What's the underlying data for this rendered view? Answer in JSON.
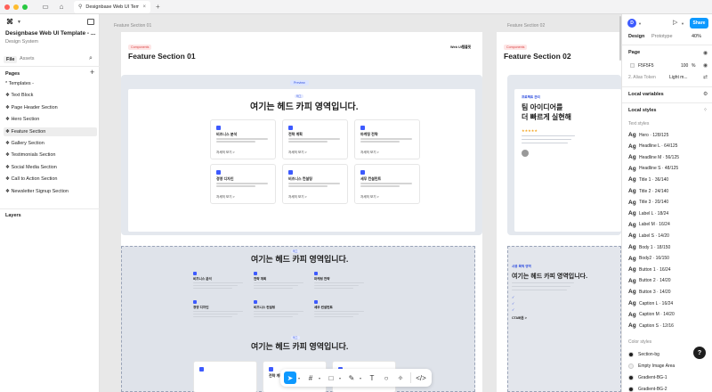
{
  "titlebar": {
    "tab_title": "Designbase Web UI Template - v",
    "close_glyph": "×",
    "plus_glyph": "+",
    "colors": {
      "red": "#ff5f57",
      "yellow": "#febc2e",
      "green": "#28c840"
    }
  },
  "left_panel": {
    "file_title": "Designbase Web UI Template - ...",
    "file_subtitle": "Design System",
    "tabs": [
      "File",
      "Assets"
    ],
    "pages_header": "Pages",
    "pages": [
      "* Templates -",
      "❖ Text Block",
      "❖ Page Header Section",
      "❖ Hero Section",
      "❖ Feature Section",
      "❖ Gallery Section",
      "❖ Testimonials Section",
      "❖ Social Media Section",
      "❖ Call to Action Section",
      "❖ Newsletter Signup Section"
    ],
    "selected_page_index": 4,
    "layers_header": "Layers"
  },
  "canvas": {
    "frame_label_1": "Feature Section 01",
    "frame_label_2": "Feature Section 02",
    "badge": "Components",
    "badge_2": "Components",
    "title_1": "Feature Section 01",
    "title_2": "Feature Section 02",
    "logo_1": "Web UI템플릿",
    "logo_2": "Web UI템플릿",
    "preview_tag": "Preview",
    "mini_pill": "태그",
    "heading": "여기는 헤드 카피 영역입니다.",
    "cards": [
      {
        "title": "비즈니스 분석",
        "more": "자세히 보기 >"
      },
      {
        "title": "전략 계획",
        "more": "자세히 보기 >"
      },
      {
        "title": "마케팅 전략",
        "more": "자세히 보기 >"
      },
      {
        "title": "경영 디자인",
        "more": "자세히 보기 >"
      },
      {
        "title": "비즈니스 컨설팅",
        "more": "자세히 보기 >"
      },
      {
        "title": "세무 컨설턴트",
        "more": "자세히 보기 >"
      }
    ],
    "section2_heading_1": "여기는 헤드 카피 영역입니다.",
    "section2_heading_2": "여기는 헤드 카피 영역입니다.",
    "right_frame": {
      "kicker": "프로젝트 관리",
      "headline_1": "팀 아이디어를",
      "headline_2": "더 빠르게 실현해",
      "kicker_2": "사용 목적 영역",
      "heading": "여기는 헤드 카피 영역입니다.",
      "cta": "CTA버튼 >"
    }
  },
  "toolbar": {
    "tools": [
      "move",
      "frame",
      "shape",
      "pen",
      "text",
      "comment",
      "actions",
      "dev-mode"
    ]
  },
  "right_panel": {
    "avatar_letter": "D",
    "share_label": "Share",
    "tabs": [
      "Design",
      "Prototype"
    ],
    "zoom": "40%",
    "page_section": "Page",
    "page_color": "F5F5F5",
    "page_opacity": "100",
    "page_opacity_unit": "%",
    "alias_label": "2. Alias Token",
    "alias_value": "Light m...",
    "local_variables": "Local variables",
    "local_styles": "Local styles",
    "text_styles_label": "Text styles",
    "text_styles": [
      "Hero · 128/125",
      "Headline L · 64/125",
      "Headline M · 56/125",
      "Headline S · 48/125",
      "Title 1 · 36/140",
      "Title 2 · 24/140",
      "Title 3 · 20/140",
      "Label L · 18/24",
      "Label M · 16/24",
      "Label S · 14/20",
      "Body 1 · 18/150",
      "Body2 · 16/150",
      "Button 1 · 16/24",
      "Button 2 · 14/20",
      "Button 3 · 14/20",
      "Caption L · 16/24",
      "Caption M · 14/20",
      "Caption S · 12/16"
    ],
    "color_styles_label": "Color styles",
    "color_styles": [
      {
        "name": "Section-bg",
        "color": "#1e1e1e"
      },
      {
        "name": "Empty Image Area",
        "color": "#eeeeee"
      },
      {
        "name": "Gradient-BG-1",
        "color": "#222222"
      },
      {
        "name": "Gradient-BG-2",
        "color": "#222222"
      }
    ],
    "help": "?"
  }
}
